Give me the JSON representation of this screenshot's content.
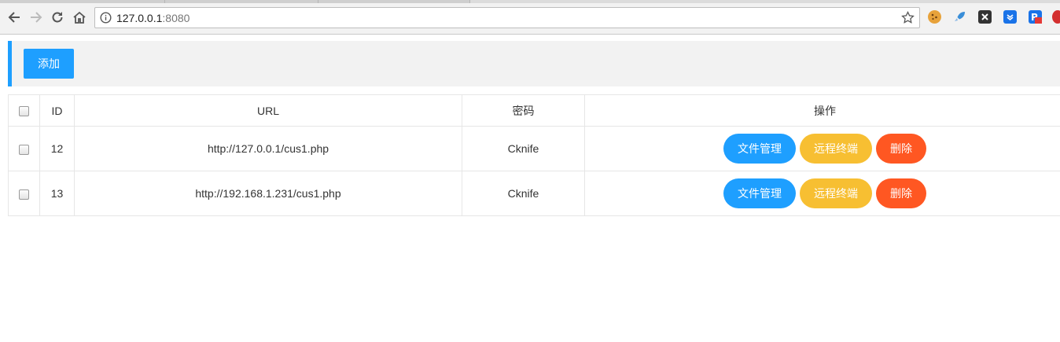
{
  "browser": {
    "url_host": "127.0.0.1",
    "url_port": ":8080"
  },
  "toolbar": {
    "add_label": "添加"
  },
  "table": {
    "headers": {
      "id": "ID",
      "url": "URL",
      "password": "密码",
      "actions": "操作"
    },
    "rows": [
      {
        "id": "12",
        "url": "http://127.0.0.1/cus1.php",
        "password": "Cknife"
      },
      {
        "id": "13",
        "url": "http://192.168.1.231/cus1.php",
        "password": "Cknife"
      }
    ],
    "actions": {
      "file_manage": "文件管理",
      "remote_terminal": "远程终端",
      "delete": "删除"
    }
  },
  "colors": {
    "primary": "#1e9fff",
    "warm": "#f7bf32",
    "danger": "#ff5722"
  },
  "icons": [
    "back-icon",
    "forward-icon",
    "reload-icon",
    "home-icon",
    "info-icon",
    "star-icon",
    "cookie-extension-icon",
    "rocket-extension-icon",
    "x-extension-icon",
    "pocket-extension-icon",
    "p-extension-icon",
    "adblock-extension-icon"
  ]
}
